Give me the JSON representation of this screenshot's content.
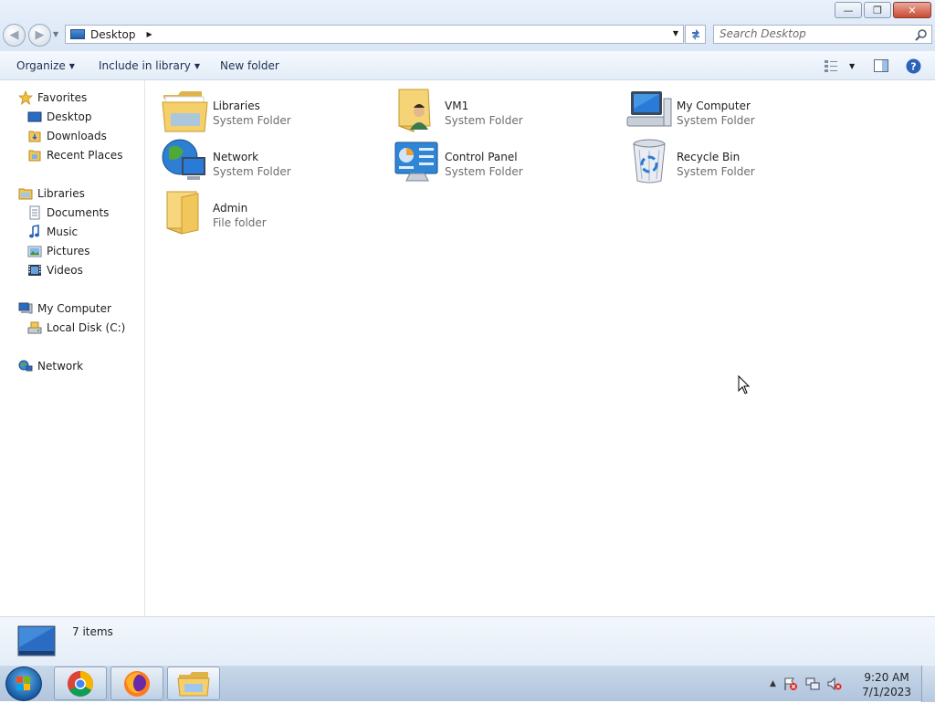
{
  "window": {
    "minimize_glyph": "—",
    "restore_glyph": "❐",
    "close_glyph": "✕"
  },
  "address": {
    "location": "Desktop",
    "search_placeholder": "Search Desktop"
  },
  "toolbar": {
    "organize": "Organize",
    "include_in_library": "Include in library",
    "new_folder": "New folder"
  },
  "nav": {
    "favorites": "Favorites",
    "desktop": "Desktop",
    "downloads": "Downloads",
    "recent_places": "Recent Places",
    "libraries": "Libraries",
    "documents": "Documents",
    "music": "Music",
    "pictures": "Pictures",
    "videos": "Videos",
    "my_computer": "My Computer",
    "local_disk": "Local Disk (C:)",
    "network": "Network"
  },
  "items": [
    {
      "name": "Libraries",
      "type": "System Folder",
      "icon": "libraries-icon"
    },
    {
      "name": "VM1",
      "type": "System Folder",
      "icon": "user-folder-icon"
    },
    {
      "name": "My Computer",
      "type": "System Folder",
      "icon": "computer-icon"
    },
    {
      "name": "Network",
      "type": "System Folder",
      "icon": "network-icon"
    },
    {
      "name": "Control Panel",
      "type": "System Folder",
      "icon": "control-panel-icon"
    },
    {
      "name": "Recycle Bin",
      "type": "System Folder",
      "icon": "recycle-bin-icon"
    },
    {
      "name": "Admin",
      "type": "File folder",
      "icon": "folder-icon"
    }
  ],
  "details": {
    "count": "7 items"
  },
  "taskbar": {
    "apps": [
      "chrome-icon",
      "firefox-icon",
      "explorer-icon"
    ],
    "time": "9:20 AM",
    "date": "7/1/2023"
  },
  "colors": {
    "accent": "#1f5fb0",
    "folder": "#f1c65a",
    "close": "#c94a33"
  }
}
